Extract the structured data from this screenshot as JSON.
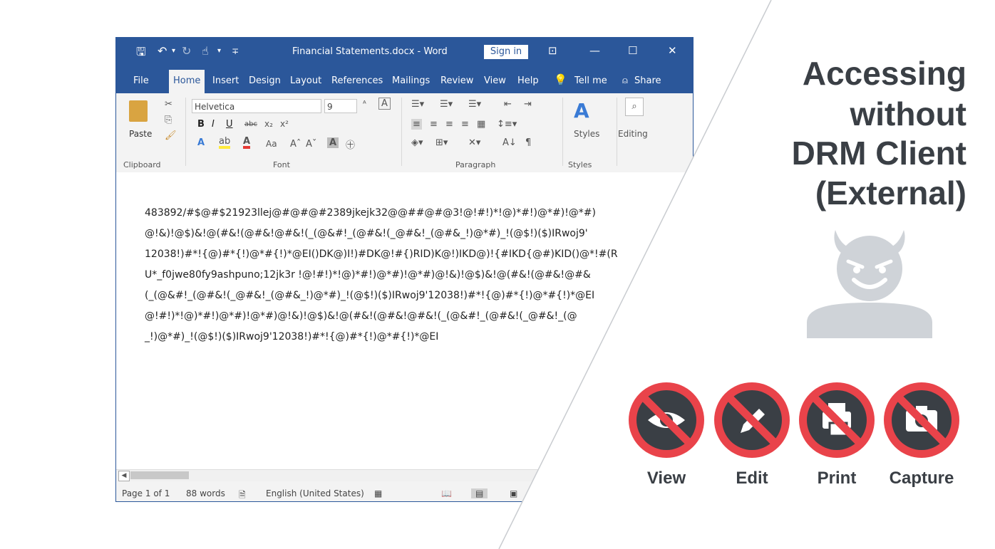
{
  "window": {
    "title": "Financial Statements.docx  -  Word",
    "sign_in": "Sign in",
    "minimize": "—",
    "maximize": "☐",
    "close": "✕",
    "ribbon_display": "⊡"
  },
  "quick_access": {
    "save": "🖫",
    "undo": "↶",
    "redo": "↻",
    "touch": "☝",
    "dropdown": "▾",
    "customize": "∓"
  },
  "tabs": [
    "File",
    "Home",
    "Insert",
    "Design",
    "Layout",
    "References",
    "Mailings",
    "Review",
    "View",
    "Help",
    "Tell me",
    "Share"
  ],
  "ribbon": {
    "paste_label": "Paste",
    "font_name": "Helvetica",
    "font_size": "9",
    "bold": "B",
    "italic": "I",
    "underline": "U",
    "strike": "abc",
    "sub": "x₂",
    "sup": "x²",
    "styles_label": "Styles",
    "editing_label": "Editing",
    "groups": [
      "Clipboard",
      "Font",
      "Paragraph",
      "Styles"
    ]
  },
  "document": {
    "lines": [
      "483892/#$@#$21923llej@#@#@#2389jkejk32@@##@#@3!@!#!)*!@)*#!)@*#)!@*#)",
      "@!&)!@$)&!@(#&!(@#&!@#&!(_(@&#!_(@#&!(_@#&!_(@#&_!)@*#)_!(@$!)($)IRwoj9'",
      "12038!)#*!{@)#*{!)@*#{!)*@EI()DK@)I!)#DK@!#{)RID)K@!)IKD@)!{#IKD{@#)KID()@*!#(R",
      "U*_f0jwe80fy9ashpuno;12jk3r !@!#!)*!@)*#!)@*#)!@*#)@!&)!@$)&!@(#&!(@#&!@#&",
      "(_(@&#!_(@#&!(_@#&!_(@#&_!)@*#)_!(@$!)($)IRwoj9'12038!)#*!{@)#*{!)@*#{!)*@EI",
      "@!#!)*!@)*#!)@*#)!@*#)@!&)!@$)&!@(#&!(@#&!@#&!(_(@&#!_(@#&!(_@#&!_(@",
      "_!)@*#)_!(@$!)($)IRwoj9'12038!)#*!{@)#*{!)@*#{!)*@EI"
    ]
  },
  "status": {
    "page": "Page 1 of 1",
    "words": "88 words",
    "language": "English (United States)"
  },
  "panel": {
    "heading_lines": [
      "Accessing",
      "without",
      "DRM Client",
      "(External)"
    ],
    "blocked_actions": [
      {
        "label": "View",
        "icon": "eye-icon"
      },
      {
        "label": "Edit",
        "icon": "pencil-icon"
      },
      {
        "label": "Print",
        "icon": "printer-icon"
      },
      {
        "label": "Capture",
        "icon": "camera-icon"
      }
    ],
    "colors": {
      "heading": "#3a3f45",
      "block_ring": "#e9434a",
      "icon_disc": "#3a3f45",
      "devil": "#cfd3d8"
    }
  }
}
